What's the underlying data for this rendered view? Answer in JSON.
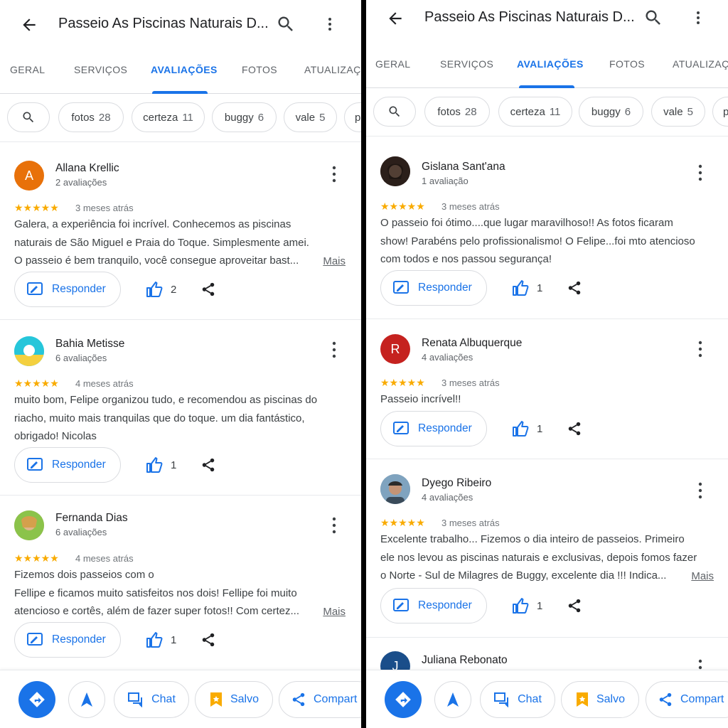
{
  "header": {
    "title": "Passeio As Piscinas Naturais D..."
  },
  "tabs": [
    "GERAL",
    "SERVIÇOS",
    "AVALIAÇÕES",
    "FOTOS",
    "ATUALIZAÇÕ"
  ],
  "chips": [
    {
      "label": "fotos",
      "count": "28"
    },
    {
      "label": "certeza",
      "count": "11"
    },
    {
      "label": "buggy",
      "count": "6"
    },
    {
      "label": "vale",
      "count": "5"
    },
    {
      "label": "p",
      "count": ""
    }
  ],
  "actions": {
    "reply_label": "Responder",
    "more_label": "Mais"
  },
  "bottom_bar": {
    "chat_label": "Chat",
    "saved_label": "Salvo",
    "share_label": "Compart"
  },
  "colors": {
    "accent": "#1a73e8",
    "star": "#f9ab00"
  },
  "left_reviews": [
    {
      "name": "Allana Krellic",
      "count": "2 avaliações",
      "date": "3 meses atrás",
      "avatar_letter": "A",
      "avatar_color": "#e8710a",
      "lines": [
        "Galera, a experiência foi incrível. Conhecemos as piscinas",
        "naturais de São Miguel e Praia do Toque. Simplesmente amei.",
        "O passeio é bem tranquilo, você consegue aproveitar bast..."
      ],
      "more": true,
      "likes": "2"
    },
    {
      "name": "Bahia Metisse",
      "count": "6 avaliações",
      "date": "4 meses atrás",
      "avatar_letter": "",
      "avatar_color": "#26c6da",
      "lines": [
        "muito bom, Felipe organizou tudo, e recomendou as piscinas do",
        "riacho, muito mais tranquilas que do toque. um dia fantástico,",
        "obrigado! Nicolas"
      ],
      "more": false,
      "likes": "1"
    },
    {
      "name": "Fernanda Dias",
      "count": "6 avaliações",
      "date": "4 meses atrás",
      "avatar_letter": "",
      "avatar_color": "#c8a27a",
      "lines": [
        "Fizemos dois passeios com o",
        "Fellipe e ficamos muito satisfeitos nos dois! Fellipe foi muito",
        "atencioso e cortês, além de fazer super fotos!! Com certez..."
      ],
      "more": true,
      "likes": "1"
    }
  ],
  "right_reviews": [
    {
      "name": "Gislana Sant'ana",
      "count": "1 avaliação",
      "date": "3 meses atrás",
      "avatar_letter": "",
      "avatar_color": "#3e2c26",
      "lines": [
        "O passeio foi ótimo....que lugar maravilhoso!! As fotos ficaram",
        "show! Parabéns pelo profissionalismo! O Felipe...foi mto atencioso",
        "com todos e nos passou segurança!"
      ],
      "more": false,
      "likes": "1"
    },
    {
      "name": "Renata Albuquerque",
      "count": "4 avaliações",
      "date": "3 meses atrás",
      "avatar_letter": "R",
      "avatar_color": "#c5221f",
      "lines": [
        "Passeio incrível!!"
      ],
      "more": false,
      "likes": "1"
    },
    {
      "name": "Dyego Ribeiro",
      "count": "4 avaliações",
      "date": "3 meses atrás",
      "avatar_letter": "",
      "avatar_color": "#6d8aa0",
      "lines": [
        "Excelente trabalho... Fizemos o dia inteiro de passeios. Primeiro",
        "ele nos levou as piscinas naturais e exclusivas, depois fomos fazer",
        "o Norte - Sul de Milagres de Buggy, excelente dia !!! Indica..."
      ],
      "more": true,
      "likes": "1"
    },
    {
      "name": "Juliana Rebonato",
      "count": "",
      "date": "",
      "avatar_letter": "J",
      "avatar_color": "#1a4e8a",
      "lines": [],
      "more": false,
      "likes": ""
    }
  ]
}
